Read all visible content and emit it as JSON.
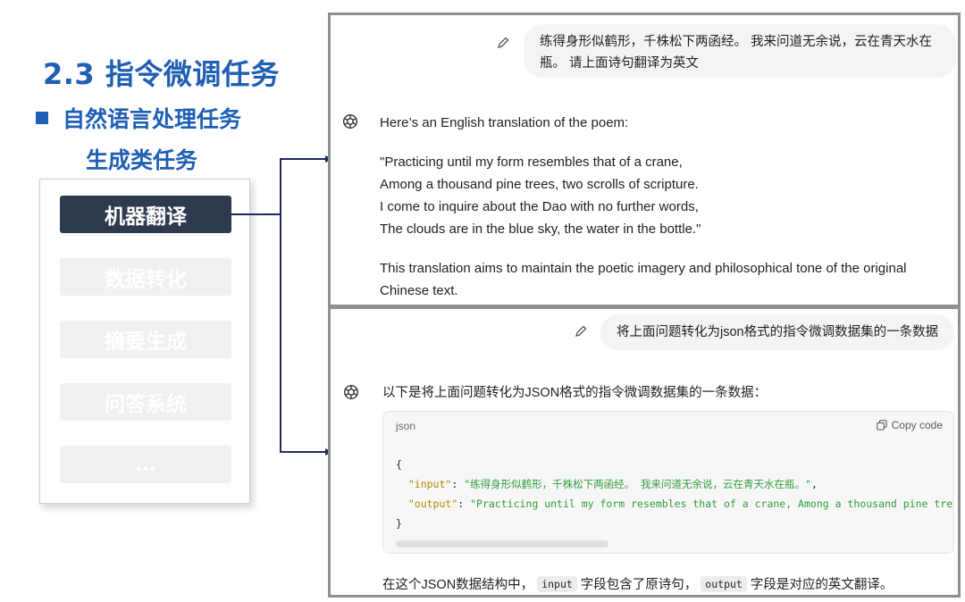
{
  "slide": {
    "title": "2.3 指令微调任务",
    "bullet": "自然语言处理任务",
    "sub": "生成类任务",
    "tasks": [
      {
        "label": "机器翻译",
        "active": true
      },
      {
        "label": "数据转化",
        "active": false
      },
      {
        "label": "摘要生成",
        "active": false
      },
      {
        "label": "问答系统",
        "active": false
      },
      {
        "label": "…",
        "active": false
      }
    ]
  },
  "chat1": {
    "user_line1": "练得身形似鹤形，千株松下两函经。 我来问道无余说，云在青天水在",
    "user_line2": "瓶。 请上面诗句翻译为英文",
    "intro": "Here’s an English translation of the poem:",
    "poem": [
      "\"Practicing until my form resembles that of a crane,",
      "Among a thousand pine trees, two scrolls of scripture.",
      "I come to inquire about the Dao with no further words,",
      "The clouds are in the blue sky, the water in the bottle.\""
    ],
    "note_line1": "This translation aims to maintain the poetic imagery and philosophical tone of the original",
    "note_line2": "Chinese text."
  },
  "chat2": {
    "user": "将上面问题转化为json格式的指令微调数据集的一条数据",
    "intro": "以下是将上面问题转化为JSON格式的指令微调数据集的一条数据：",
    "code_lang": "json",
    "copy_label": "Copy code",
    "code": {
      "open": "{",
      "input_key": "\"input\"",
      "input_val": "\"练得身形似鹤形，千株松下两函经。 我来问道无余说，云在青天水在瓶。\"",
      "output_key": "\"output\"",
      "output_val": "\"Practicing until my form resembles that of a crane, Among a thousand pine tre",
      "close": "}"
    },
    "footer_pre": "在这个JSON数据结构中，",
    "footer_code1": "input",
    "footer_mid": "字段包含了原诗句，",
    "footer_code2": "output",
    "footer_post": "字段是对应的英文翻译。"
  },
  "colors": {
    "title_blue": "#1f5fb4",
    "active_task": "#2e3a4e",
    "connector": "#1b2d5e",
    "json_key": "#b58900",
    "json_string": "#2e9c3a"
  },
  "icons": [
    "edit-pencil-icon",
    "chatgpt-logo-icon",
    "copy-icon",
    "arrow-right-icon"
  ]
}
